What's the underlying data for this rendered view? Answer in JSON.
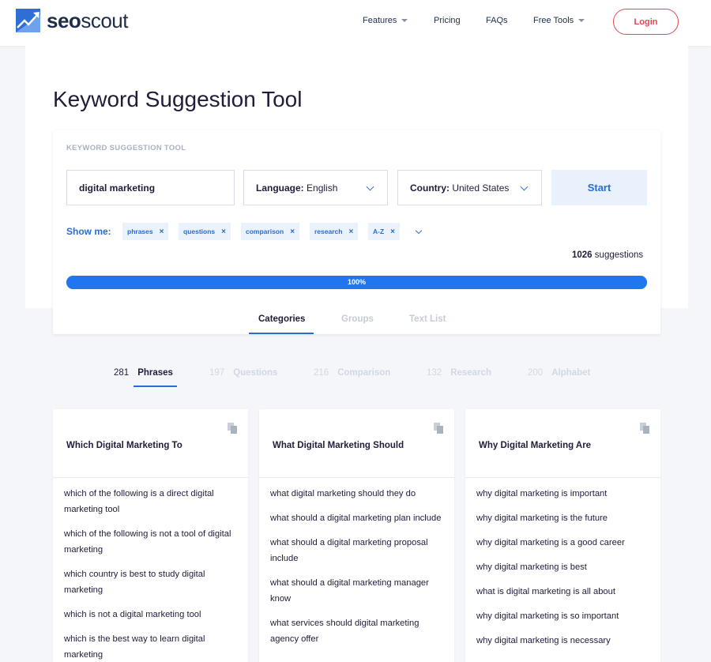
{
  "header": {
    "logo_bold": "seo",
    "logo_light": "scout",
    "nav": [
      "Features",
      "Pricing",
      "FAQs",
      "Free Tools"
    ],
    "login": "Login"
  },
  "page": {
    "title": "Keyword Suggestion Tool",
    "panel_label": "KEYWORD SUGGESTION TOOL",
    "keyword_value": "digital marketing",
    "language_label": "Language:",
    "language_value": "English",
    "country_label": "Country:",
    "country_value": "United States",
    "start": "Start",
    "show_me": "Show me:",
    "chips": [
      "phrases",
      "questions",
      "comparison",
      "research",
      "A-Z"
    ],
    "chip_close": "×",
    "suggestion_count": "1026",
    "suggestion_word": "suggestions",
    "progress_text": "100%",
    "progress_value": 100
  },
  "tabs": [
    "Categories",
    "Groups",
    "Text List"
  ],
  "categories": [
    {
      "count": "281",
      "name": "Phrases"
    },
    {
      "count": "197",
      "name": "Questions"
    },
    {
      "count": "216",
      "name": "Comparison"
    },
    {
      "count": "132",
      "name": "Research"
    },
    {
      "count": "200",
      "name": "Alphabet"
    }
  ],
  "cards": [
    {
      "title": "Which Digital Marketing To",
      "items": [
        "which of the following is a direct digital marketing tool",
        "which of the following is not a tool of digital marketing",
        "which country is best to study digital marketing",
        "which is not a digital marketing tool",
        "which is the best way to learn digital marketing"
      ]
    },
    {
      "title": "What Digital Marketing Should",
      "items": [
        "what digital marketing should they do",
        "what should a digital marketing plan include",
        "what should a digital marketing proposal include",
        "what should a digital marketing manager know",
        "what services should digital marketing agency offer"
      ]
    },
    {
      "title": "Why Digital Marketing Are",
      "items": [
        "why digital marketing is important",
        "why digital marketing is the future",
        "why digital marketing is a good career",
        "why digital marketing is best",
        "what is digital marketing is all about",
        "why digital marketing is so important",
        "why digital marketing is necessary"
      ]
    }
  ]
}
